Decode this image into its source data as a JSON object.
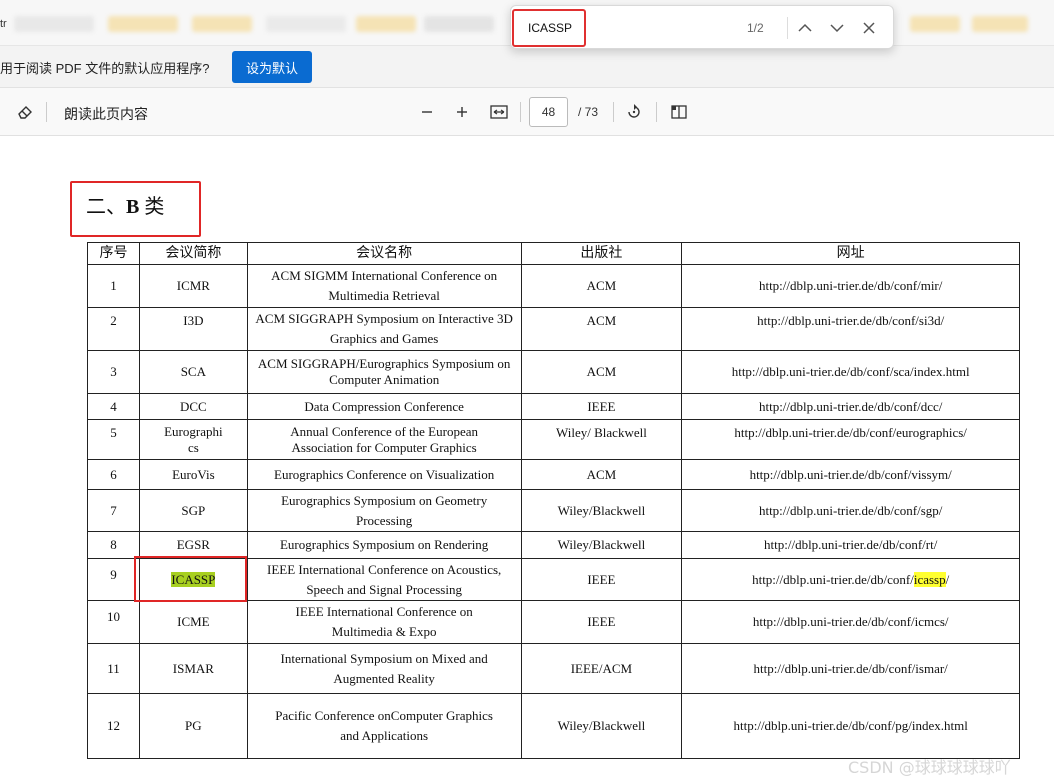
{
  "topbar": {
    "lead": "tr"
  },
  "default_bar": {
    "message": "用于阅读 PDF 文件的默认应用程序?",
    "set_default_label": "设为默认"
  },
  "toolbar": {
    "read_aloud": "朗读此页内容",
    "page_current": "48",
    "page_total": "/ 73"
  },
  "find": {
    "query": "ICASSP",
    "count": "1/2"
  },
  "document": {
    "heading_prefix": "二、",
    "heading_bold": "B",
    "heading_suffix": " 类",
    "columns": [
      "序号",
      "会议简称",
      "会议名称",
      "出版社",
      "网址"
    ],
    "rows": [
      {
        "no": "1",
        "abbr": "ICMR",
        "name": "ACM SIGMM International Conference on Multimedia Retrieval",
        "pub": "ACM",
        "url": "http://dblp.uni-trier.de/db/conf/mir/"
      },
      {
        "no": "2",
        "abbr": "I3D",
        "name": "ACM SIGGRAPH Symposium on Interactive 3D Graphics and Games",
        "pub": "ACM",
        "url": "http://dblp.uni-trier.de/db/conf/si3d/"
      },
      {
        "no": "3",
        "abbr": "SCA",
        "name": "ACM SIGGRAPH/Eurographics Symposium on Computer Animation",
        "pub": "ACM",
        "url": "http://dblp.uni-trier.de/db/conf/sca/index.html"
      },
      {
        "no": "4",
        "abbr": "DCC",
        "name": "Data Compression Conference",
        "pub": "IEEE",
        "url": "http://dblp.uni-trier.de/db/conf/dcc/"
      },
      {
        "no": "5",
        "abbr": "Eurographics",
        "name": "Annual Conference of the European Association for Computer Graphics",
        "pub": "Wiley/ Blackwell",
        "url": "http://dblp.uni-trier.de/db/conf/eurographics/"
      },
      {
        "no": "6",
        "abbr": "EuroVis",
        "name": "Eurographics Conference on Visualization",
        "pub": "ACM",
        "url": "http://dblp.uni-trier.de/db/conf/vissym/"
      },
      {
        "no": "7",
        "abbr": "SGP",
        "name": "Eurographics Symposium on Geometry Processing",
        "pub": "Wiley/Blackwell",
        "url": "http://dblp.uni-trier.de/db/conf/sgp/"
      },
      {
        "no": "8",
        "abbr": "EGSR",
        "name": "Eurographics Symposium on Rendering",
        "pub": "Wiley/Blackwell",
        "url": "http://dblp.uni-trier.de/db/conf/rt/"
      },
      {
        "no": "9",
        "abbr": "ICASSP",
        "name": "IEEE International Conference on Acoustics, Speech and Signal Processing",
        "pub": "IEEE",
        "url_pre": "http://dblp.uni-trier.de/db/conf/",
        "url_hl": "icassp",
        "url_post": "/"
      },
      {
        "no": "10",
        "abbr": "ICME",
        "name": "IEEE International Conference on Multimedia & Expo",
        "pub": "IEEE",
        "url": "http://dblp.uni-trier.de/db/conf/icmcs/"
      },
      {
        "no": "11",
        "abbr": "ISMAR",
        "name": "International Symposium on Mixed and Augmented Reality",
        "pub": "IEEE/ACM",
        "url": "http://dblp.uni-trier.de/db/conf/ismar/"
      },
      {
        "no": "12",
        "abbr": "PG",
        "name": "Pacific Conference onComputer Graphics and Applications",
        "pub": "Wiley/Blackwell",
        "url": "http://dblp.uni-trier.de/db/conf/pg/index.html"
      }
    ]
  },
  "watermark": "CSDN @球球球球球吖",
  "colors": {
    "accent": "#0a6bd1",
    "highlight_current": "#a8d020",
    "highlight_match": "#ffff30",
    "annotation": "#e02626"
  },
  "icons": [
    "eraser-icon",
    "zoom-out-icon",
    "zoom-in-icon",
    "fit-width-icon",
    "rotate-icon",
    "two-page-icon",
    "chevron-up-icon",
    "chevron-down-icon",
    "close-icon"
  ]
}
